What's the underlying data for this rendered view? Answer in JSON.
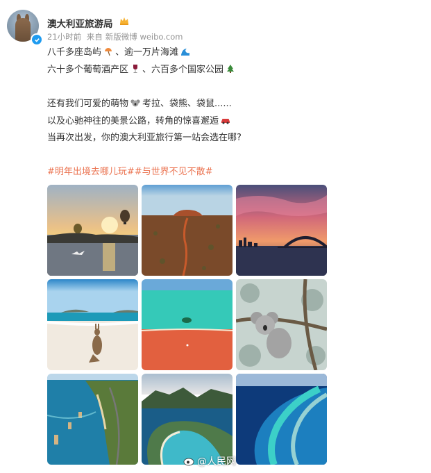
{
  "post": {
    "username": "澳大利亚旅游局",
    "time": "21小时前",
    "source_prefix": "来自",
    "source": "新版微博 weibo.com",
    "lines": {
      "l1a": "八千多座岛屿",
      "l1b": "、逾一万片海滩",
      "l2a": "六十多个葡萄酒产区",
      "l2b": "、六百多个国家公园",
      "l3a": "还有我们可爱的萌物",
      "l3b": "考拉、袋熊、袋鼠......",
      "l4a": "以及心驰神往的美景公路，转角的惊喜邂逅",
      "l5": "当再次出发，你的澳大利亚旅行第一站会选在哪?"
    },
    "tags": "#明年出境去哪儿玩##与世界不见不散#"
  },
  "photos": [
    {
      "name": "hot-air-balloon-sunrise"
    },
    {
      "name": "uluru-red-desert"
    },
    {
      "name": "sydney-harbour-bridge-sunset"
    },
    {
      "name": "kangaroo-on-beach"
    },
    {
      "name": "pink-lake-aerial"
    },
    {
      "name": "koala-in-tree"
    },
    {
      "name": "great-ocean-road"
    },
    {
      "name": "wineglass-bay"
    },
    {
      "name": "great-barrier-reef"
    }
  ],
  "watermark": "@人民网",
  "colors": {
    "tag": "#eb7350",
    "meta": "#939393",
    "verified": "#1e9bf0"
  }
}
